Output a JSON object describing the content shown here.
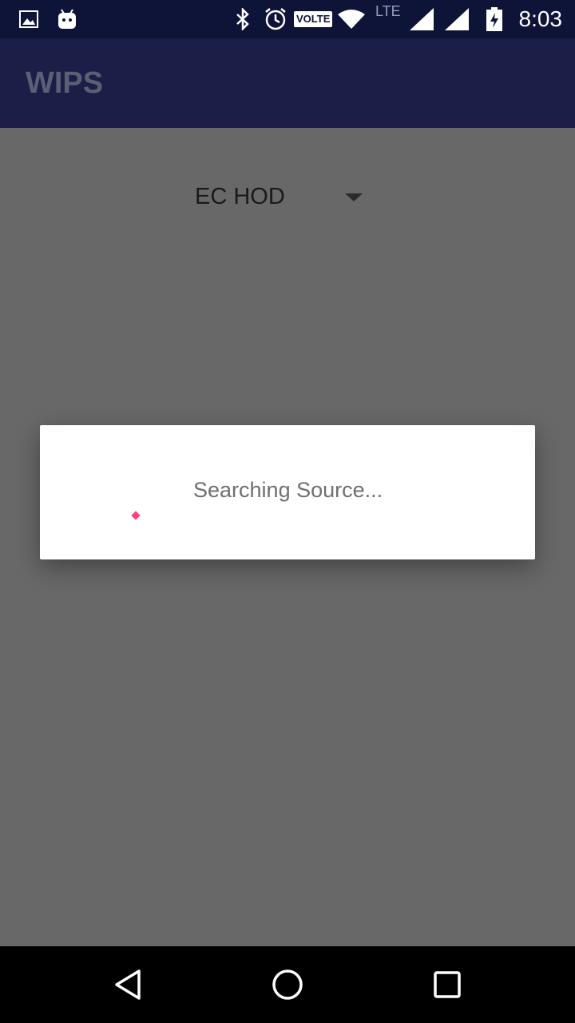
{
  "status_bar": {
    "time": "8:03",
    "volte": "VOLTE",
    "network": "LTE",
    "icons": [
      "gallery-icon",
      "android-debug-icon",
      "bluetooth-icon",
      "alarm-icon",
      "wifi-icon",
      "signal-icon",
      "signal-icon",
      "battery-charging-icon"
    ]
  },
  "app_bar": {
    "title": "WIPS"
  },
  "spinner": {
    "selected": "EC HOD"
  },
  "dialog": {
    "message": "Searching Source...",
    "accent_color": "#ff4081"
  },
  "nav_bar": {
    "icons": [
      "back-icon",
      "home-icon",
      "recents-icon"
    ]
  },
  "colors": {
    "status_bar": "#0e1338",
    "app_bar": "#1b1f48",
    "scrim": "#686868"
  }
}
